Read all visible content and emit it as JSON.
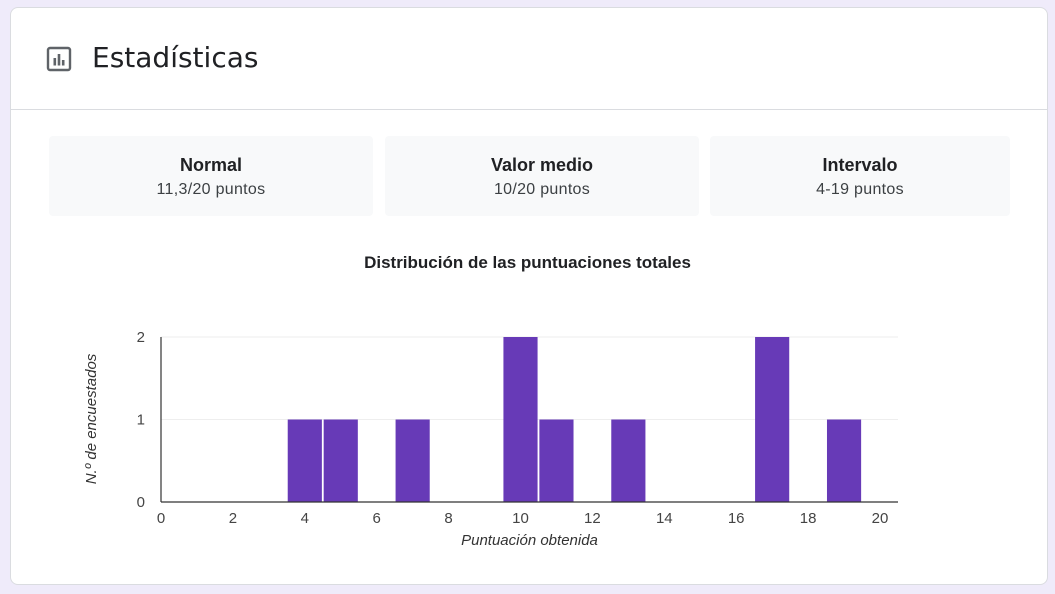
{
  "header": {
    "title": "Estadísticas",
    "icon": "bar-chart-icon"
  },
  "stats": [
    {
      "label": "Normal",
      "value": "11,3/20 puntos"
    },
    {
      "label": "Valor medio",
      "value": "10/20 puntos"
    },
    {
      "label": "Intervalo",
      "value": "4-19 puntos"
    }
  ],
  "colors": {
    "bar": "#673ab7",
    "background": "#efebfa"
  },
  "chart_data": {
    "type": "bar",
    "title": "Distribución de las puntuaciones totales",
    "xlabel": "Puntuación obtenida",
    "ylabel": "N.º de encuestados",
    "x": [
      4,
      5,
      7,
      10,
      11,
      13,
      17,
      19
    ],
    "values": [
      1,
      1,
      1,
      2,
      1,
      1,
      2,
      1
    ],
    "xlim": [
      0,
      20
    ],
    "ylim": [
      0,
      2
    ],
    "xticks": [
      "0",
      "2",
      "4",
      "6",
      "8",
      "10",
      "12",
      "14",
      "16",
      "18",
      "20"
    ],
    "yticks": [
      "0",
      "1",
      "2"
    ],
    "grid": true
  }
}
